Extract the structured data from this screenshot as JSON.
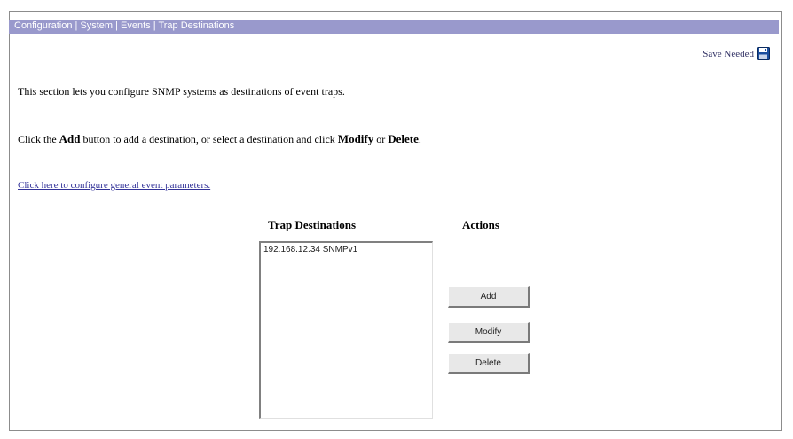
{
  "breadcrumb": "Configuration | System | Events | Trap Destinations",
  "save_needed": "Save Needed",
  "save_icon": "floppy-disk-icon",
  "intro": {
    "line1": "This section lets you configure SNMP systems as destinations of event traps.",
    "line2_prefix": "Click the ",
    "line2_add": "Add",
    "line2_mid": " button to add a destination, or select a destination and click ",
    "line2_modify": "Modify",
    "line2_or": " or ",
    "line2_delete": "Delete",
    "line2_end": "."
  },
  "config_link": "Click here to configure general event parameters.",
  "trap_destinations": {
    "heading": "Trap Destinations",
    "items": [
      "192.168.12.34 SNMPv1"
    ]
  },
  "actions": {
    "heading": "Actions",
    "add": "Add",
    "modify": "Modify",
    "delete": "Delete"
  },
  "colors": {
    "titlebar": "#9999cc",
    "link": "#333399"
  }
}
